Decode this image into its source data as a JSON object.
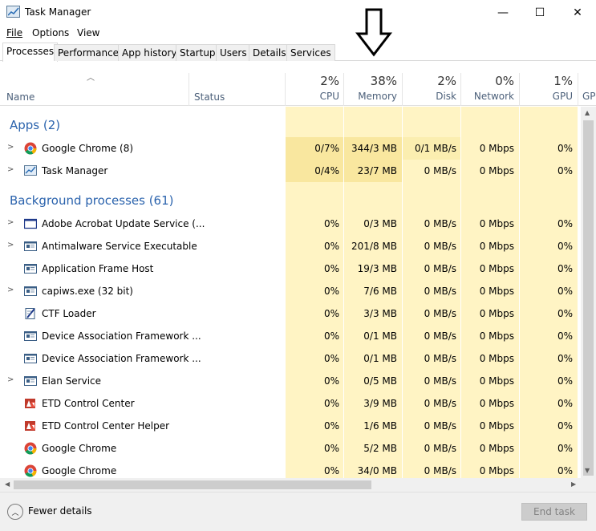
{
  "window": {
    "title": "Task Manager",
    "minimize_glyph": "—",
    "maximize_glyph": "☐",
    "close_glyph": "✕"
  },
  "menu": [
    "File",
    "Options",
    "View"
  ],
  "tabs": [
    "Processes",
    "Performance",
    "App history",
    "Startup",
    "Users",
    "Details",
    "Services"
  ],
  "header": {
    "name": "Name",
    "status": "Status",
    "cpu_pct": "2%",
    "cpu_label": "CPU",
    "mem_pct": "38%",
    "mem_label": "Memory",
    "disk_pct": "2%",
    "disk_label": "Disk",
    "net_pct": "0%",
    "net_label": "Network",
    "gpu_pct": "1%",
    "gpu_label": "GPU",
    "gpu2_label": "GP"
  },
  "groups": {
    "apps": "Apps (2)",
    "background": "Background processes (61)"
  },
  "apps": [
    {
      "name": "Google Chrome (8)",
      "icon": "chrome-icon",
      "cpu": "0/7%",
      "memory": "344/3 MB",
      "disk": "0/1 MB/s",
      "network": "0 Mbps",
      "gpu": "0%"
    },
    {
      "name": "Task Manager",
      "icon": "task-manager-icon",
      "cpu": "0/4%",
      "memory": "23/7 MB",
      "disk": "0 MB/s",
      "network": "0 Mbps",
      "gpu": "0%"
    }
  ],
  "background": [
    {
      "name": "Adobe Acrobat Update Service (...",
      "icon": "window-icon",
      "cpu": "0%",
      "memory": "0/3 MB",
      "disk": "0 MB/s",
      "network": "0 Mbps",
      "gpu": "0%"
    },
    {
      "name": "Antimalware Service Executable",
      "icon": "service-icon",
      "cpu": "0%",
      "memory": "201/8 MB",
      "disk": "0 MB/s",
      "network": "0 Mbps",
      "gpu": "0%"
    },
    {
      "name": "Application Frame Host",
      "icon": "service-icon",
      "cpu": "0%",
      "memory": "19/3 MB",
      "disk": "0 MB/s",
      "network": "0 Mbps",
      "gpu": "0%"
    },
    {
      "name": "capiws.exe (32 bit)",
      "icon": "service-icon",
      "cpu": "0%",
      "memory": "7/6 MB",
      "disk": "0 MB/s",
      "network": "0 Mbps",
      "gpu": "0%"
    },
    {
      "name": "CTF Loader",
      "icon": "ctf-loader-icon",
      "cpu": "0%",
      "memory": "3/3 MB",
      "disk": "0 MB/s",
      "network": "0 Mbps",
      "gpu": "0%"
    },
    {
      "name": "Device Association Framework ...",
      "icon": "service-icon",
      "cpu": "0%",
      "memory": "0/1 MB",
      "disk": "0 MB/s",
      "network": "0 Mbps",
      "gpu": "0%"
    },
    {
      "name": "Device Association Framework ...",
      "icon": "service-icon",
      "cpu": "0%",
      "memory": "0/1 MB",
      "disk": "0 MB/s",
      "network": "0 Mbps",
      "gpu": "0%"
    },
    {
      "name": "Elan Service",
      "icon": "service-icon",
      "cpu": "0%",
      "memory": "0/5 MB",
      "disk": "0 MB/s",
      "network": "0 Mbps",
      "gpu": "0%"
    },
    {
      "name": "ETD Control Center",
      "icon": "etd-icon",
      "cpu": "0%",
      "memory": "3/9 MB",
      "disk": "0 MB/s",
      "network": "0 Mbps",
      "gpu": "0%"
    },
    {
      "name": "ETD Control Center Helper",
      "icon": "etd-icon",
      "cpu": "0%",
      "memory": "1/6 MB",
      "disk": "0 MB/s",
      "network": "0 Mbps",
      "gpu": "0%"
    },
    {
      "name": "Google Chrome",
      "icon": "chrome-icon",
      "cpu": "0%",
      "memory": "5/2 MB",
      "disk": "0 MB/s",
      "network": "0 Mbps",
      "gpu": "0%"
    },
    {
      "name": "Google Chrome",
      "icon": "chrome-icon",
      "cpu": "0%",
      "memory": "34/0 MB",
      "disk": "0 MB/s",
      "network": "0 Mbps",
      "gpu": "0%"
    }
  ],
  "footer": {
    "fewer_details": "Fewer details",
    "end_task": "End task"
  }
}
